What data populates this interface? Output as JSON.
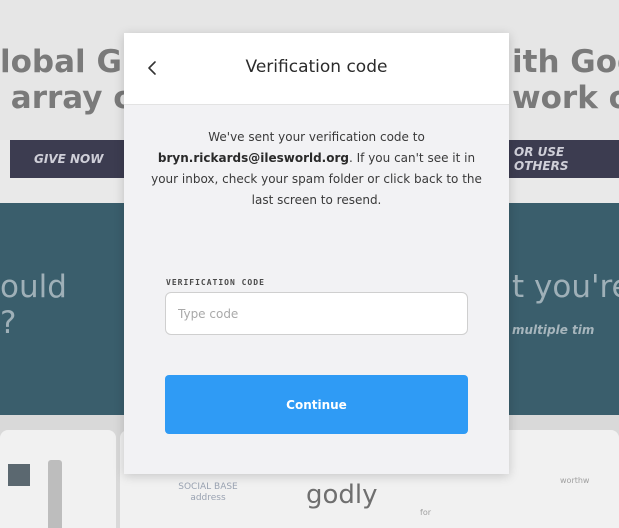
{
  "background": {
    "heading_left": "lobal Gi\n array o",
    "heading_right": "ith God\nwork of",
    "give_now_label": "GIVE NOW",
    "right_button_label": "OR USE OTHERS",
    "band_left_text": "ould\n?",
    "band_right_text": "t you're",
    "band_right_small": "multiple tim",
    "lower_small_label": "SOCIAL BASE\naddress",
    "lower_word": "godly",
    "lower_tiny": "for",
    "lower_tiny2": "worthw"
  },
  "modal": {
    "back_icon": "chevron-left-icon",
    "title": "Verification code",
    "message_before": "We've sent your verification code to",
    "email": "bryn.rickards@ilesworld.org",
    "message_after": ". If you can't see it in your inbox, check your spam folder or click back to the last screen to resend.",
    "field_label": "VERIFICATION CODE",
    "input_value": "",
    "input_placeholder": "Type code",
    "continue_label": "Continue",
    "accent_color": "#2f9bf5"
  }
}
